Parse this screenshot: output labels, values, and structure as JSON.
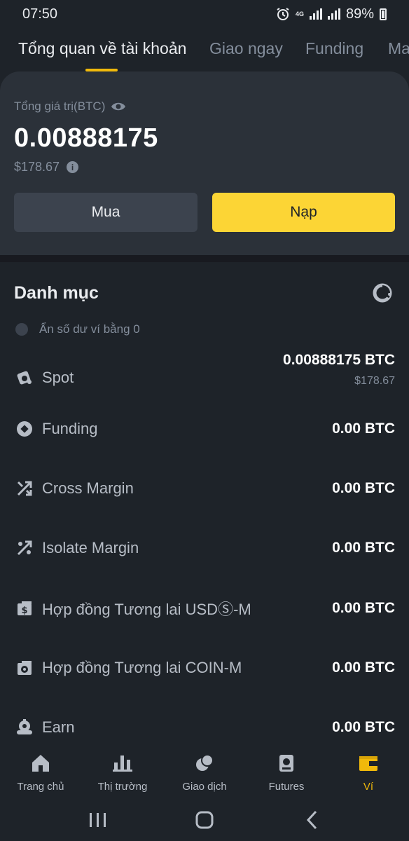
{
  "status_bar": {
    "time": "07:50",
    "network": "4G",
    "battery": "89%"
  },
  "tabs": [
    {
      "label": "Tổng quan về tài khoản",
      "active": true
    },
    {
      "label": "Giao ngay",
      "active": false
    },
    {
      "label": "Funding",
      "active": false
    },
    {
      "label": "Ma",
      "active": false
    }
  ],
  "overview": {
    "total_label": "Tổng giá trị(BTC)",
    "total_btc": "0.00888175",
    "total_usd": "$178.67",
    "buy_label": "Mua",
    "deposit_label": "Nạp"
  },
  "portfolio": {
    "title": "Danh mục",
    "hide_small_label": "Ẩn số dư ví bằng 0",
    "accounts": [
      {
        "name": "Spot",
        "icon": "spot-icon",
        "amount": "0.00888175 BTC",
        "usd": "$178.67"
      },
      {
        "name": "Funding",
        "icon": "funding-icon",
        "amount": "0.00 BTC"
      },
      {
        "name": "Cross Margin",
        "icon": "cross-margin-icon",
        "amount": "0.00 BTC"
      },
      {
        "name": "Isolate Margin",
        "icon": "isolate-margin-icon",
        "amount": "0.00 BTC"
      },
      {
        "name": "Hợp đồng Tương lai USDⓈ-M",
        "icon": "usd-futures-icon",
        "amount": "0.00 BTC"
      },
      {
        "name": "Hợp đồng Tương lai COIN-M",
        "icon": "coin-futures-icon",
        "amount": "0.00 BTC"
      },
      {
        "name": "Earn",
        "icon": "earn-icon",
        "amount": "0.00 BTC"
      }
    ]
  },
  "bottom_nav": [
    {
      "label": "Trang chủ",
      "icon": "home-icon",
      "active": false
    },
    {
      "label": "Thị trường",
      "icon": "markets-icon",
      "active": false
    },
    {
      "label": "Giao dịch",
      "icon": "trade-icon",
      "active": false
    },
    {
      "label": "Futures",
      "icon": "futures-icon",
      "active": false
    },
    {
      "label": "Ví",
      "icon": "wallet-icon",
      "active": true
    }
  ],
  "colors": {
    "accent": "#fcd535",
    "background": "#1e2329",
    "card": "#2b3139",
    "muted": "#848e9c"
  }
}
